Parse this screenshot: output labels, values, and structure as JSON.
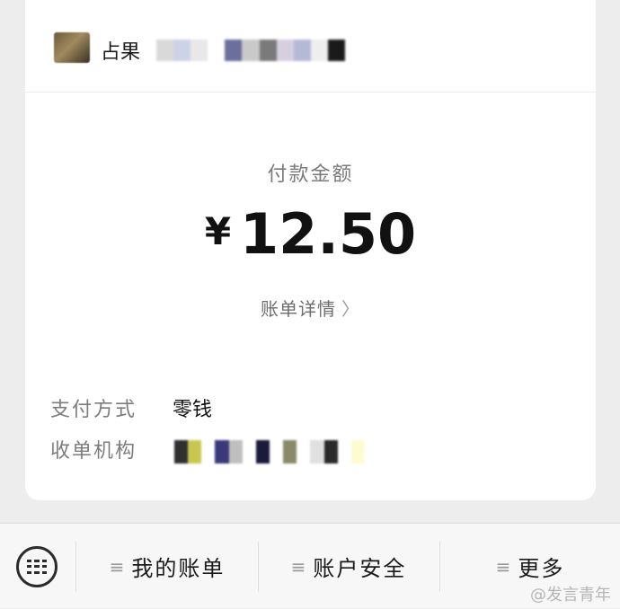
{
  "merchant": {
    "avatar_icon": "merchant-avatar",
    "name_visible": "占果",
    "mosaic_colors": [
      "#d9d9d9",
      "#cdd3e6",
      "#e8e8e8",
      "#ffffff",
      "#6a6f9c",
      "#c9c9c9",
      "#7a7a7a",
      "#d6d0de",
      "#b6b9d6",
      "#eeeeee",
      "#1a1a1a"
    ]
  },
  "payment": {
    "amount_label": "付款金额",
    "currency": "¥",
    "amount": "12.50",
    "bill_detail_label": "账单详情",
    "bill_detail_chevron": "〉"
  },
  "details": {
    "payment_method_label": "支付方式",
    "payment_method_value": "零钱",
    "acquirer_label": "收单机构",
    "acquirer_mosaic_colors": [
      "#303030",
      "#c8c850",
      "#ffffff",
      "#3a3a7a",
      "#bfbfbf",
      "#ffffff",
      "#1a1a3a",
      "#ffffff",
      "#8a8a6a",
      "#ffffff",
      "#e0e0e0",
      "#2a2a2a",
      "#ffffff",
      "#fffbd0"
    ]
  },
  "bottom_bar": {
    "keyboard_icon": "keyboard-icon",
    "menu_icon": "≡",
    "items": [
      {
        "label": "我的账单"
      },
      {
        "label": "账户安全"
      },
      {
        "label": "更多"
      }
    ]
  },
  "watermark": "@发言青年"
}
